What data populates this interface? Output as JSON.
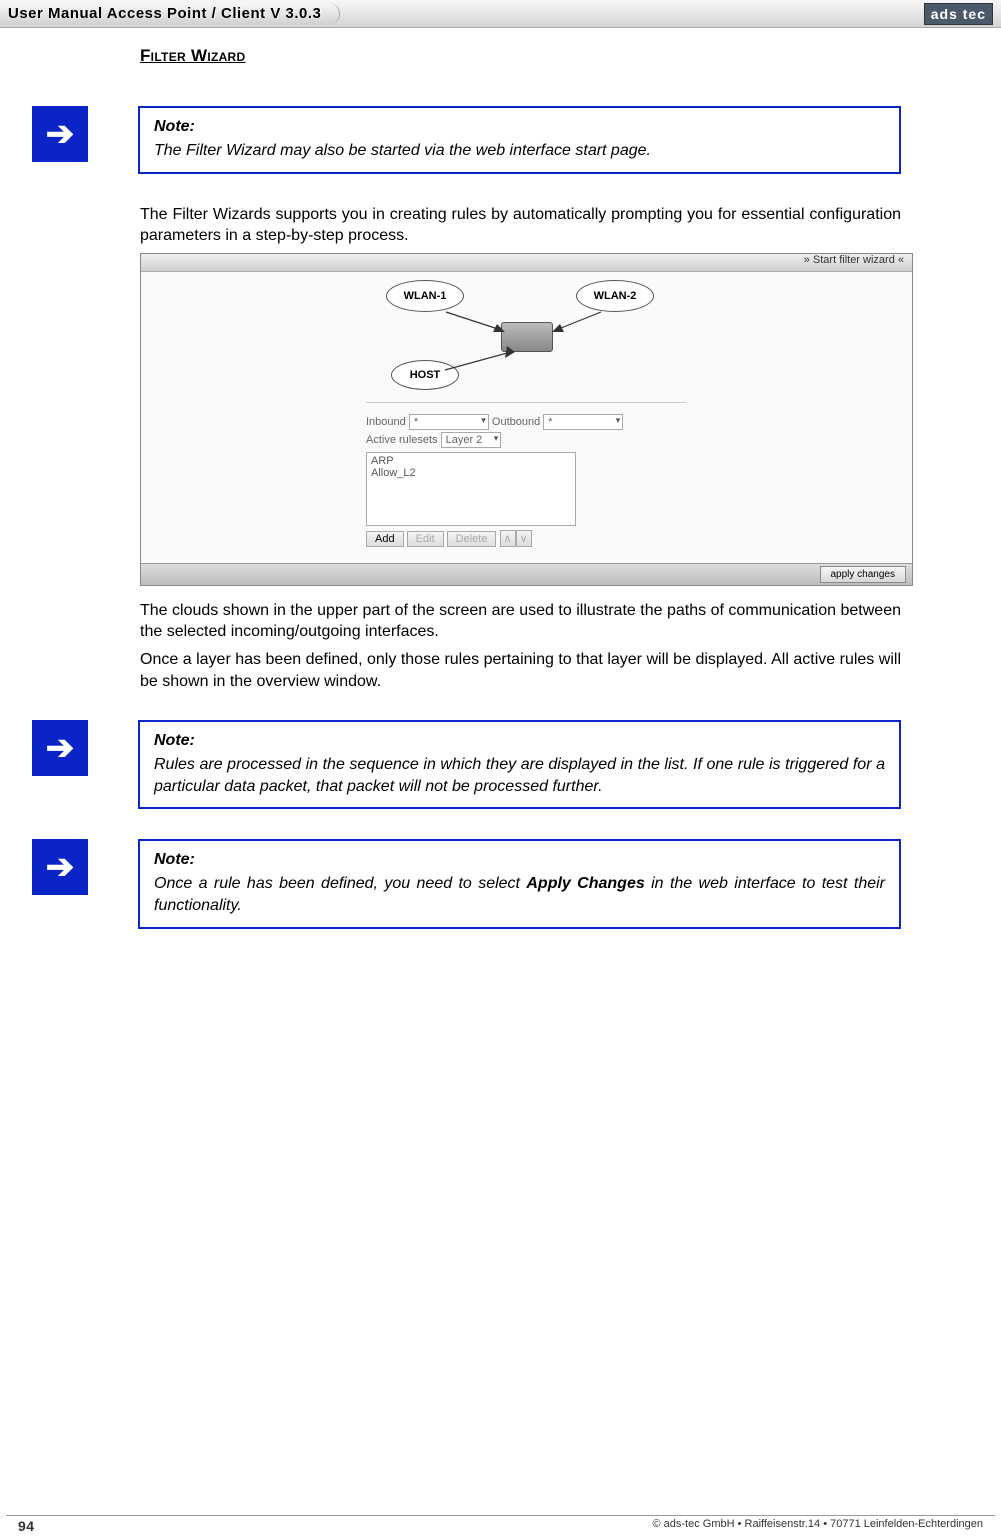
{
  "header": {
    "title": "User Manual Access Point / Client V 3.0.3",
    "logo": "ads tec"
  },
  "section": {
    "title": "Filter Wizard"
  },
  "note1": {
    "label": "Note:",
    "text": "The Filter Wizard may also be started via the web interface start page."
  },
  "para1": "The Filter Wizards supports you in creating rules by automatically prompting you for essential configuration parameters in a step-by-step process.",
  "screenshot": {
    "top_link": "» Start filter wizard «",
    "wlan1": "WLAN-1",
    "wlan2": "WLAN-2",
    "host": "HOST",
    "row_inbound_label": "Inbound",
    "row_inbound_value": "*",
    "row_outbound_label": "Outbound",
    "row_outbound_value": "*",
    "row_active_label": "Active rulesets",
    "row_active_value": "Layer 2",
    "list_item1": "ARP",
    "list_item2": "Allow_L2",
    "btn_add": "Add",
    "btn_edit": "Edit",
    "btn_delete": "Delete",
    "apply": "apply changes"
  },
  "para2": "The clouds shown in the upper part of the screen are used to illustrate the paths of communication between the selected incoming/outgoing interfaces.",
  "para3": "Once a layer has been defined, only those rules pertaining to that layer will be displayed. All active rules will be shown in the overview window.",
  "note2": {
    "label": "Note:",
    "text": "Rules are processed in the sequence in which they are displayed in the list. If one rule is triggered for a particular data packet, that packet will not be processed further."
  },
  "note3": {
    "label": "Note:",
    "text_pre": "Once a rule has been defined, you need to select ",
    "text_strong": "Apply Changes",
    "text_post": " in the web interface to test their functionality."
  },
  "footer": {
    "page": "94",
    "copyright": "© ads-tec GmbH • Raiffeisenstr.14 • 70771 Leinfelden-Echterdingen"
  }
}
